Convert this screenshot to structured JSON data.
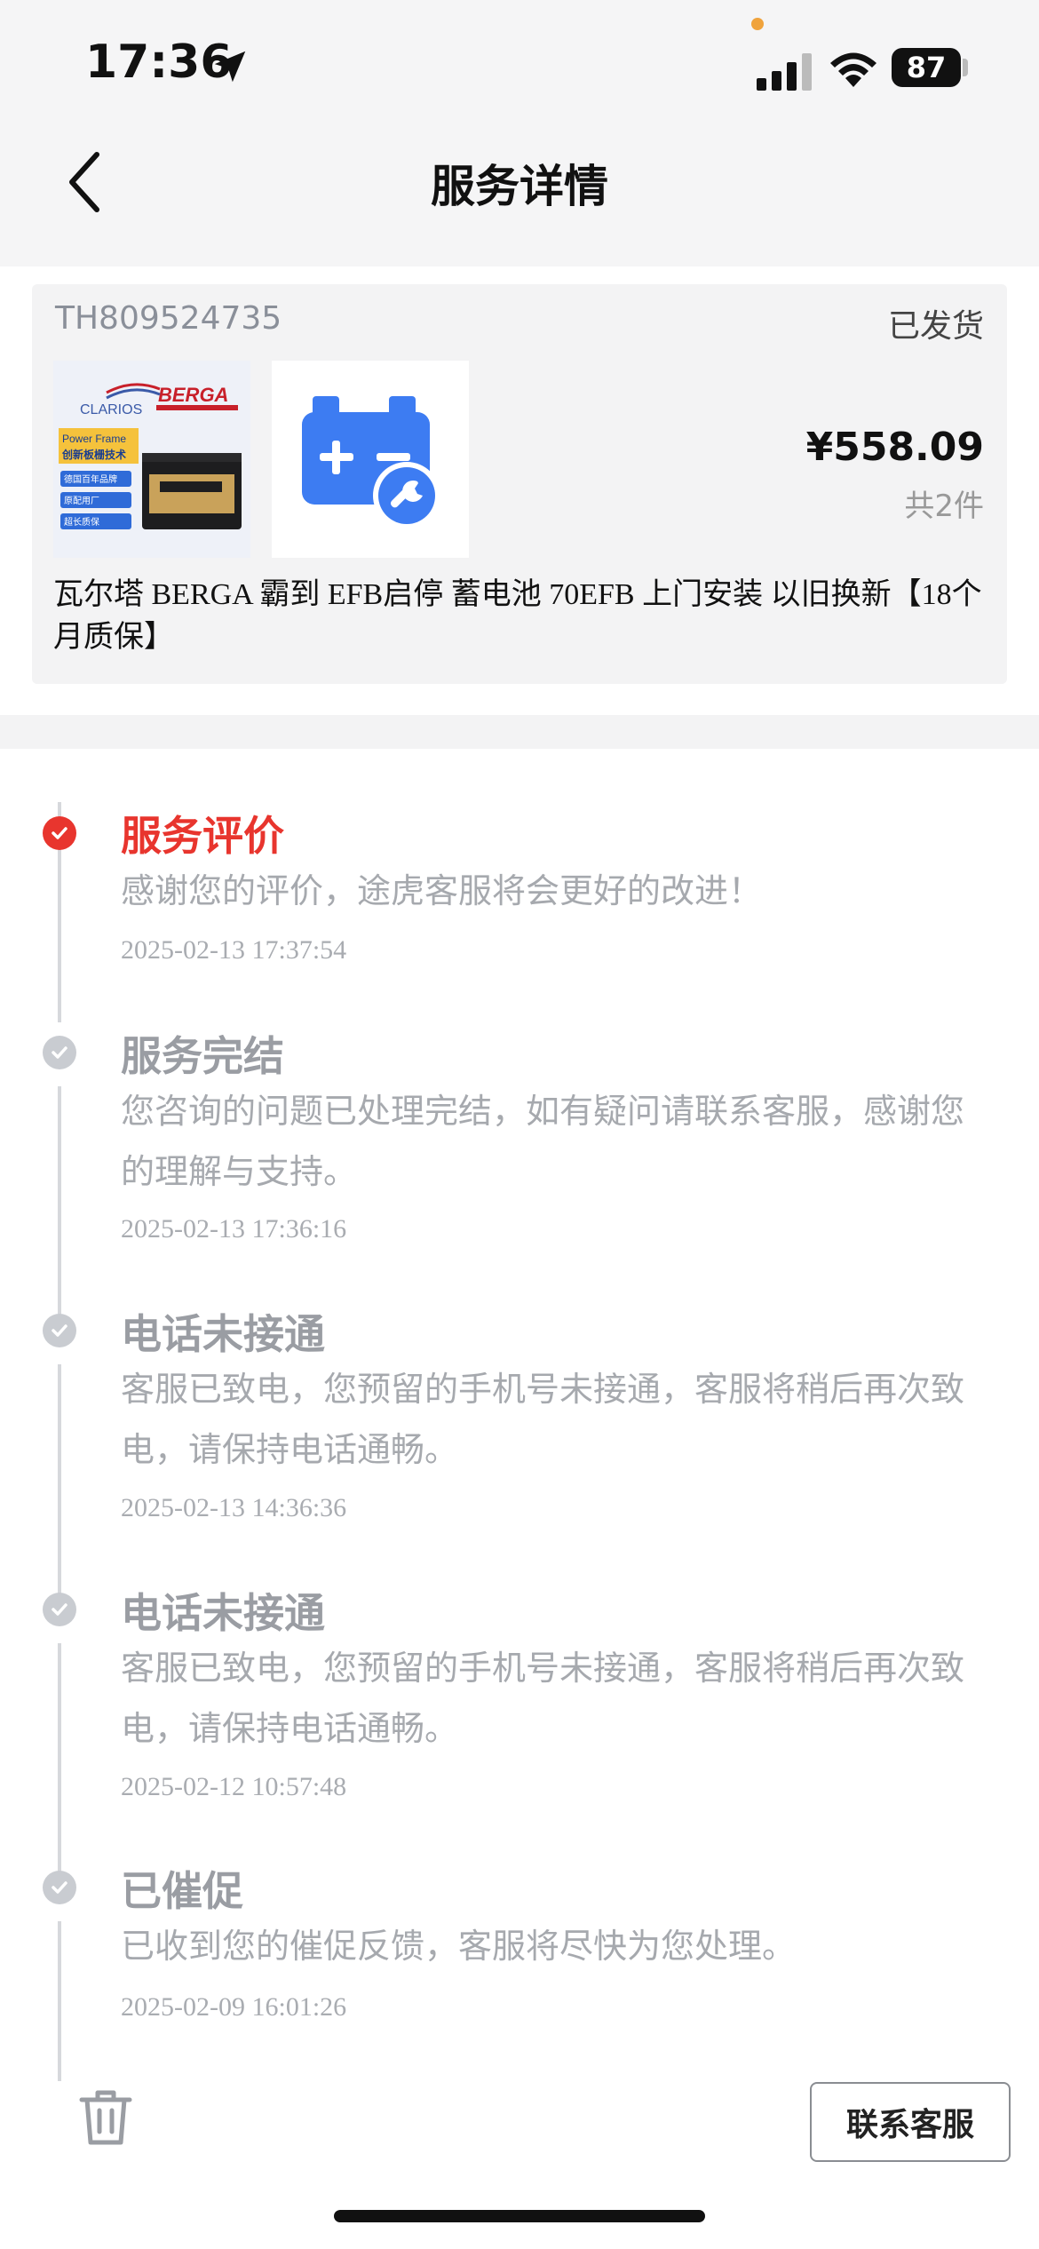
{
  "status_bar": {
    "time": "17:36",
    "battery": "87"
  },
  "header": {
    "title": "服务详情"
  },
  "order": {
    "order_no": "TH809524735",
    "status": "已发货",
    "price": "¥558.09",
    "quantity": "共2件",
    "product_title": "瓦尔塔 BERGA 霸到 EFB启停 蓄电池 70EFB 上门安装 以旧换新【18个月质保】",
    "thumb1": {
      "brand_left": "CLARIOS",
      "brand_right": "BERGA",
      "tag_line1": "Power Frame",
      "tag_line2": "创新板栅技术",
      "badges": [
        "德国百年品牌",
        "原配用厂",
        "超长质保"
      ]
    }
  },
  "timeline": [
    {
      "title": "服务评价",
      "desc": "感谢您的评价，途虎客服将会更好的改进！",
      "time": "2025-02-13 17:37:54",
      "state": "active"
    },
    {
      "title": "服务完结",
      "desc": "您咨询的问题已处理完结，如有疑问请联系客服，感谢您的理解与支持。",
      "time": "2025-02-13 17:36:16",
      "state": "done"
    },
    {
      "title": "电话未接通",
      "desc": "客服已致电，您预留的手机号未接通，客服将稍后再次致电，请保持电话通畅。",
      "time": "2025-02-13 14:36:36",
      "state": "done"
    },
    {
      "title": "电话未接通",
      "desc": "客服已致电，您预留的手机号未接通，客服将稍后再次致电，请保持电话通畅。",
      "time": "2025-02-12 10:57:48",
      "state": "done"
    },
    {
      "title": "已催促",
      "desc": "已收到您的催促反馈，客服将尽快为您处理。",
      "time": "2025-02-09 16:01:26",
      "state": "done"
    }
  ],
  "bottom_bar": {
    "contact_label": "联系客服"
  },
  "colors": {
    "accent_red": "#e8352e",
    "icon_blue": "#3d7cf2"
  }
}
